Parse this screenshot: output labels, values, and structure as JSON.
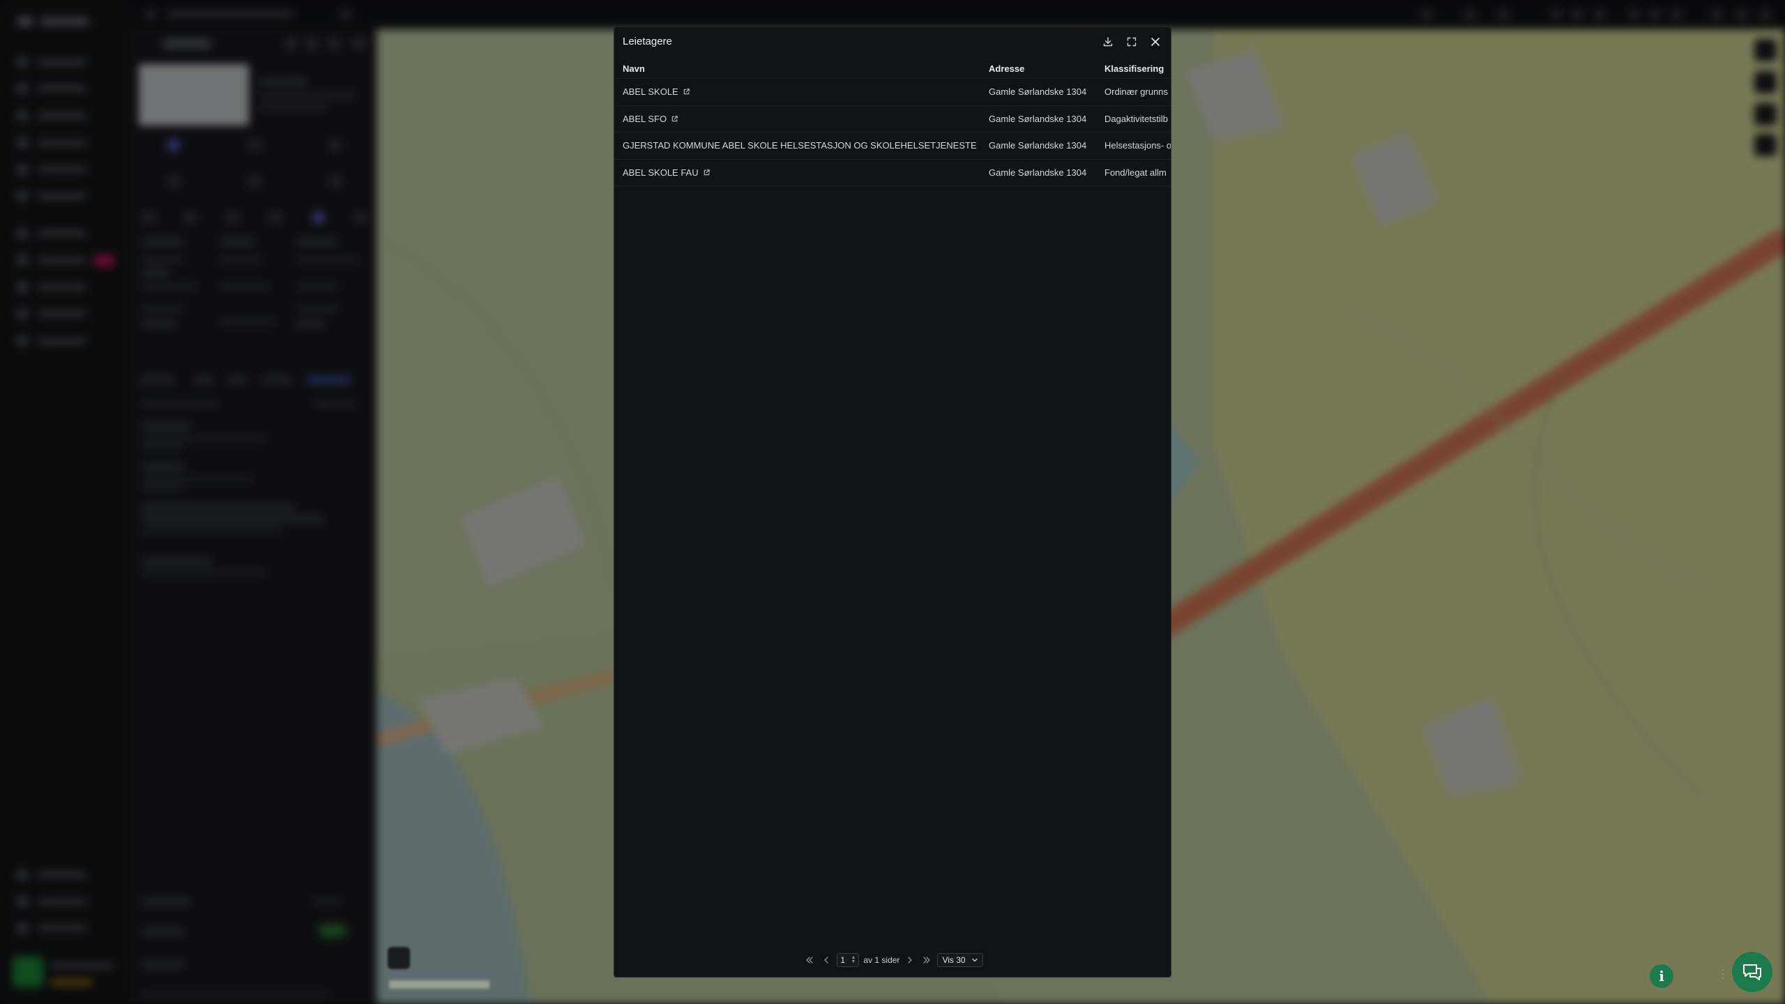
{
  "modal": {
    "title": "Leietagere",
    "actions": [
      {
        "name": "download",
        "icon": "download-icon"
      },
      {
        "name": "fullscreen",
        "icon": "expand-icon"
      },
      {
        "name": "close",
        "icon": "close-icon"
      }
    ]
  },
  "table": {
    "columns": [
      "Navn",
      "Adresse",
      "Klassifisering"
    ],
    "rows": [
      {
        "navn": "ABEL SKOLE",
        "adresse": "Gamle Sørlandske 1304",
        "klassifisering": "Ordinær grunns"
      },
      {
        "navn": "ABEL SFO",
        "adresse": "Gamle Sørlandske 1304",
        "klassifisering": "Dagaktivitetstilb"
      },
      {
        "navn": "GJERSTAD KOMMUNE ABEL SKOLE HELSESTASJON OG SKOLEHELSETJENESTE",
        "adresse": "Gamle Sørlandske 1304",
        "klassifisering": "Helsestasjons- o"
      },
      {
        "navn": "ABEL SKOLE FAU",
        "adresse": "Gamle Sørlandske 1304",
        "klassifisering": "Fond/legat allm"
      }
    ]
  },
  "pager": {
    "current_page": "1",
    "of_label": "av 1 sider",
    "page_size_label": "Vis 30"
  },
  "colors": {
    "accent_green": "#1d7a4d",
    "modal_bg": "#111214"
  }
}
